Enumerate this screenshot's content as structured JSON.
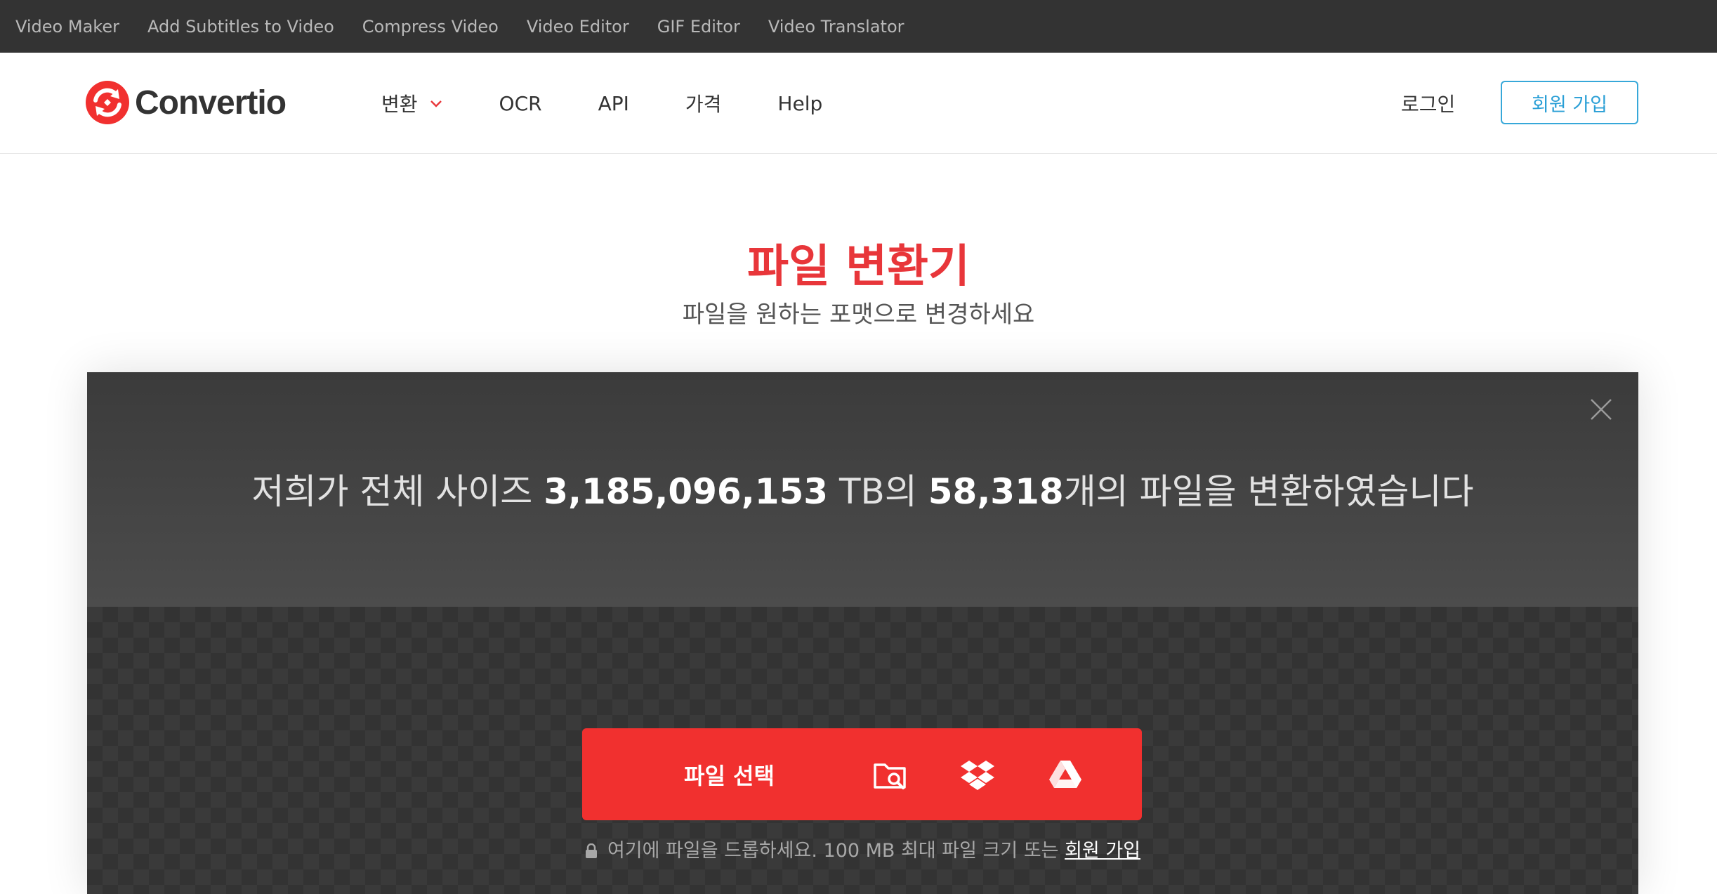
{
  "topbar": {
    "links": [
      "Video Maker",
      "Add Subtitles to Video",
      "Compress Video",
      "Video Editor",
      "GIF Editor",
      "Video Translator"
    ]
  },
  "header": {
    "logo_text": "Convertio",
    "nav": {
      "convert": "변환",
      "ocr": "OCR",
      "api": "API",
      "pricing": "가격",
      "help": "Help"
    },
    "login": "로그인",
    "signup": "회원 가입"
  },
  "hero": {
    "title": "파일 변환기",
    "subtitle": "파일을 원하는 포맷으로 변경하세요"
  },
  "stats": {
    "prefix": "저희가 전체 사이즈 ",
    "size": "3,185,096,153",
    "unit": " TB의 ",
    "count": "58,318",
    "suffix": "개의 파일을 변환하였습니다"
  },
  "upload": {
    "button_label": "파일 선택",
    "sources": [
      "folder-search-icon",
      "dropbox-icon",
      "google-drive-icon"
    ],
    "hint": "여기에 파일을 드롭하세요. 100 MB 최대 파일 크기 또는 ",
    "hint_link": "회원 가입"
  },
  "colors": {
    "topbar_bg": "#333333",
    "brand_red": "#f1302f",
    "title_red": "#e8363a",
    "signup_blue": "#2a9fd6",
    "panel_dark": "#3a3a3a"
  }
}
